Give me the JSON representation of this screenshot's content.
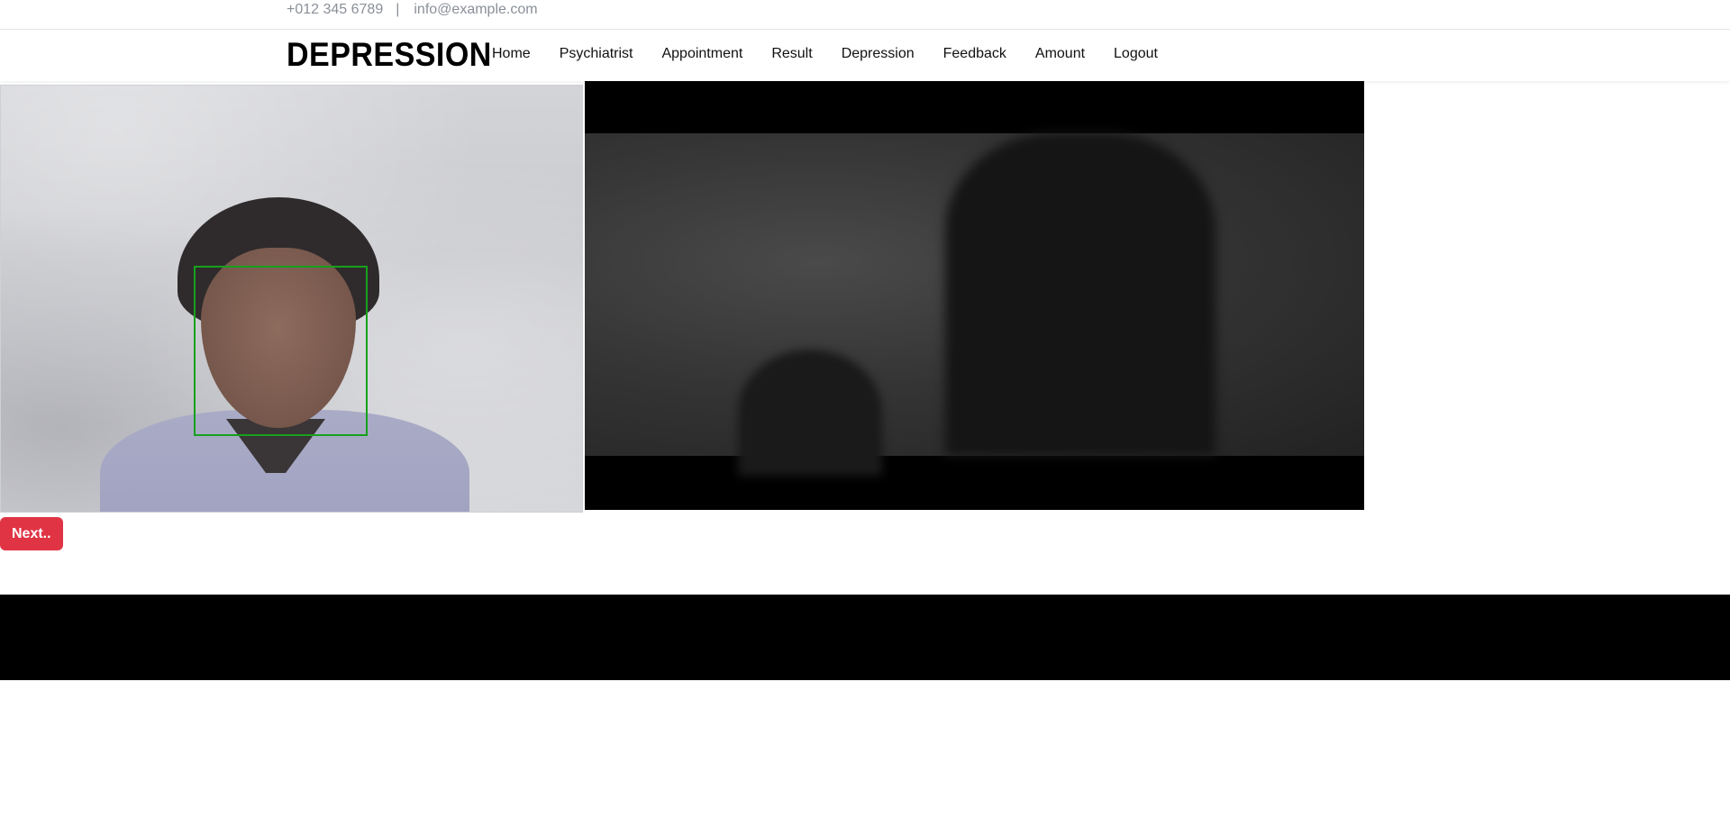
{
  "topbar": {
    "phone": "+012 345 6789",
    "separator": "|",
    "email": "info@example.com"
  },
  "navbar": {
    "brand": "DEPRESSION",
    "items": [
      {
        "label": "Home"
      },
      {
        "label": "Psychiatrist"
      },
      {
        "label": "Appointment"
      },
      {
        "label": "Result"
      },
      {
        "label": "Depression"
      },
      {
        "label": "Feedback"
      },
      {
        "label": "Amount"
      },
      {
        "label": "Logout"
      }
    ]
  },
  "main": {
    "next_label": "Next..",
    "accent_color": "#e03444",
    "detection_box_color": "#16a11d"
  }
}
